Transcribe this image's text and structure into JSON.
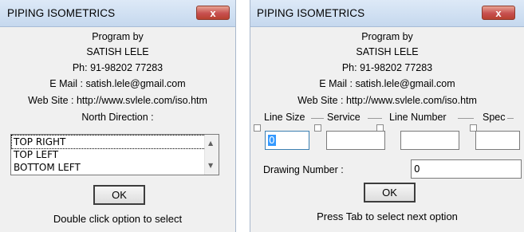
{
  "window_left": {
    "title": "PIPING ISOMETRICS",
    "close_label": "x",
    "program_by": "Program by",
    "author": "SATISH LELE",
    "phone": "Ph: 91-98202 77283",
    "email": "E Mail : satish.lele@gmail.com",
    "website": "Web Site : http://www.svlele.com/iso.htm",
    "north_label": "North Direction :",
    "north_options": [
      "TOP RIGHT",
      "TOP LEFT",
      "BOTTOM LEFT"
    ],
    "selected_option": "TOP RIGHT",
    "ok_label": "OK",
    "hint": "Double click option to select"
  },
  "window_right": {
    "title": "PIPING ISOMETRICS",
    "close_label": "x",
    "program_by": "Program by",
    "author": "SATISH LELE",
    "phone": "Ph: 91-98202 77283",
    "email": "E Mail : satish.lele@gmail.com",
    "website": "Web Site : http://www.svlele.com/iso.htm",
    "fields": {
      "line_size_label": "Line Size",
      "service_label": "Service",
      "line_number_label": "Line Number",
      "spec_label": "Spec",
      "line_size_value": "0",
      "service_value": "",
      "line_number_value": "",
      "spec_value": ""
    },
    "drawing_number_label": "Drawing Number :",
    "drawing_number_value": "0",
    "ok_label": "OK",
    "hint": "Press Tab to select next option"
  },
  "colors": {
    "titlebar_top": "#dde9f7",
    "titlebar_bottom": "#c5d8ee",
    "close_red": "#c75050",
    "dialog_bg": "#f0f0f0",
    "selection_blue": "#3399ff"
  },
  "icons": {
    "scroll_up": "triangle-up",
    "scroll_down": "triangle-down",
    "close": "x-mark"
  }
}
